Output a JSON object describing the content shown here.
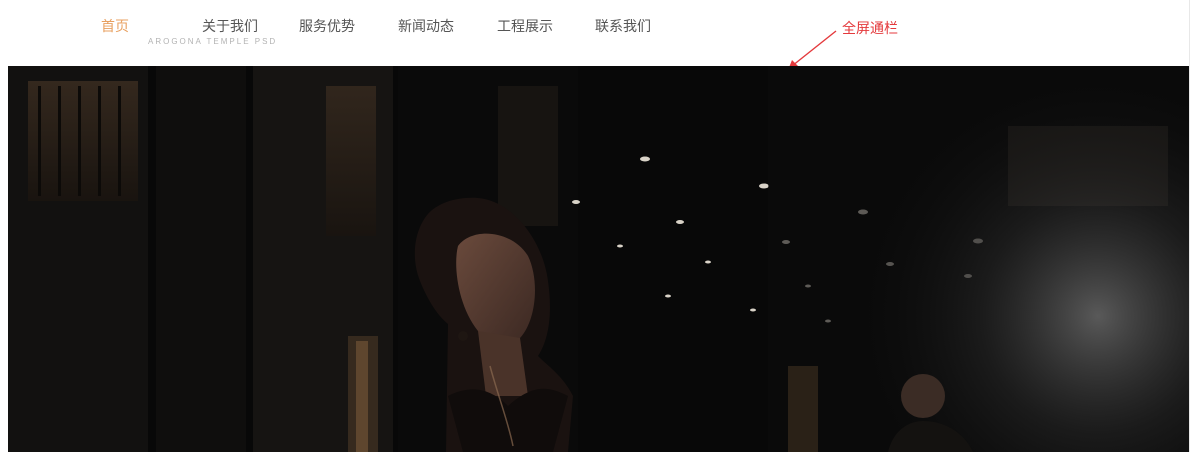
{
  "nav": {
    "items": [
      {
        "label": "首页",
        "active": true
      },
      {
        "label": "关于我们",
        "active": false
      },
      {
        "label": "服务优势",
        "active": false
      },
      {
        "label": "新闻动态",
        "active": false
      },
      {
        "label": "工程展示",
        "active": false
      },
      {
        "label": "联系我们",
        "active": false
      }
    ],
    "subtitle": "AROGONA TEMPLE PSD"
  },
  "annotation": {
    "label": "全屏通栏",
    "color": "#e4393c"
  },
  "colors": {
    "active_nav": "#e8a060",
    "nav_text": "#555555",
    "hero_background": "#050505"
  }
}
